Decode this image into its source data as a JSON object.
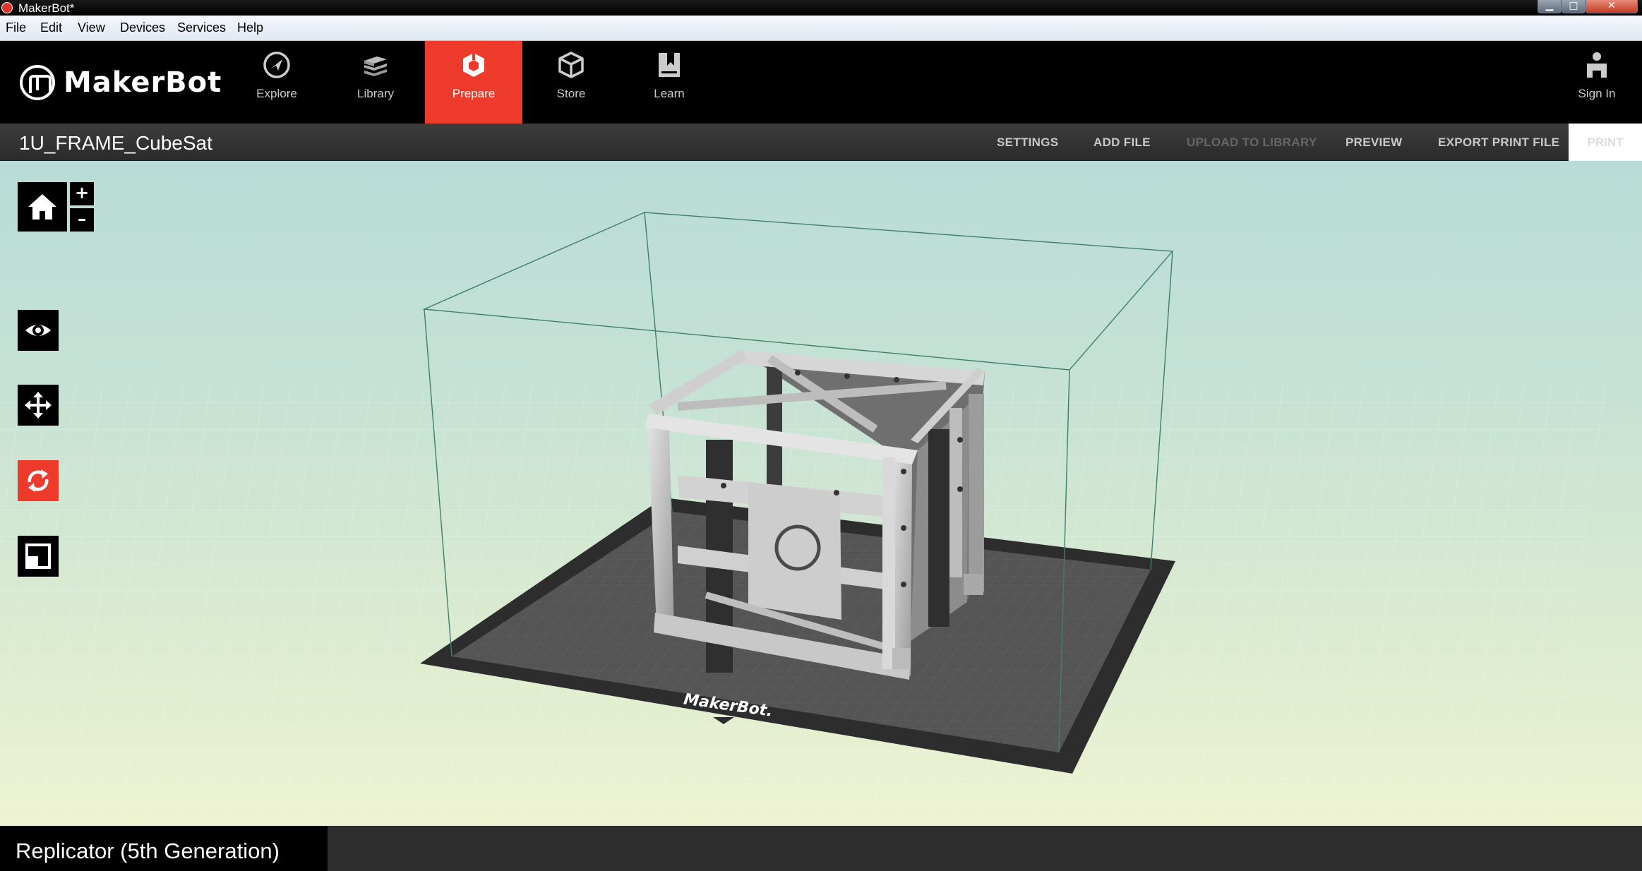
{
  "window": {
    "title": "MakerBot*",
    "minimize": "▁",
    "maximize": "□",
    "close": "✕"
  },
  "menu": [
    "File",
    "Edit",
    "View",
    "Devices",
    "Services",
    "Help"
  ],
  "brand": {
    "name": "MakerBot"
  },
  "nav": {
    "tabs": [
      {
        "label": "Explore",
        "icon": "compass-icon"
      },
      {
        "label": "Library",
        "icon": "library-icon"
      },
      {
        "label": "Prepare",
        "icon": "prepare-icon",
        "active": true
      },
      {
        "label": "Store",
        "icon": "store-icon"
      },
      {
        "label": "Learn",
        "icon": "learn-icon"
      }
    ],
    "signin": "Sign In"
  },
  "subbar": {
    "filename": "1U_FRAME_CubeSat",
    "actions": [
      {
        "label": "SETTINGS",
        "enabled": true
      },
      {
        "label": "ADD FILE",
        "enabled": true
      },
      {
        "label": "UPLOAD TO LIBRARY",
        "enabled": false
      },
      {
        "label": "PREVIEW",
        "enabled": true
      },
      {
        "label": "EXPORT PRINT FILE",
        "enabled": true
      }
    ],
    "print": "PRINT"
  },
  "viewport": {
    "zoom_in": "+",
    "zoom_out": "–",
    "tools": [
      "view-icon",
      "move-icon",
      "rotate-icon",
      "scale-icon"
    ],
    "active_tool": "rotate-icon",
    "plate_brand": "MakerBot."
  },
  "status": {
    "printer": "Replicator (5th Generation)"
  },
  "colors": {
    "accent": "#ed3a2b",
    "header": "#000000",
    "subbar": "#333333"
  }
}
